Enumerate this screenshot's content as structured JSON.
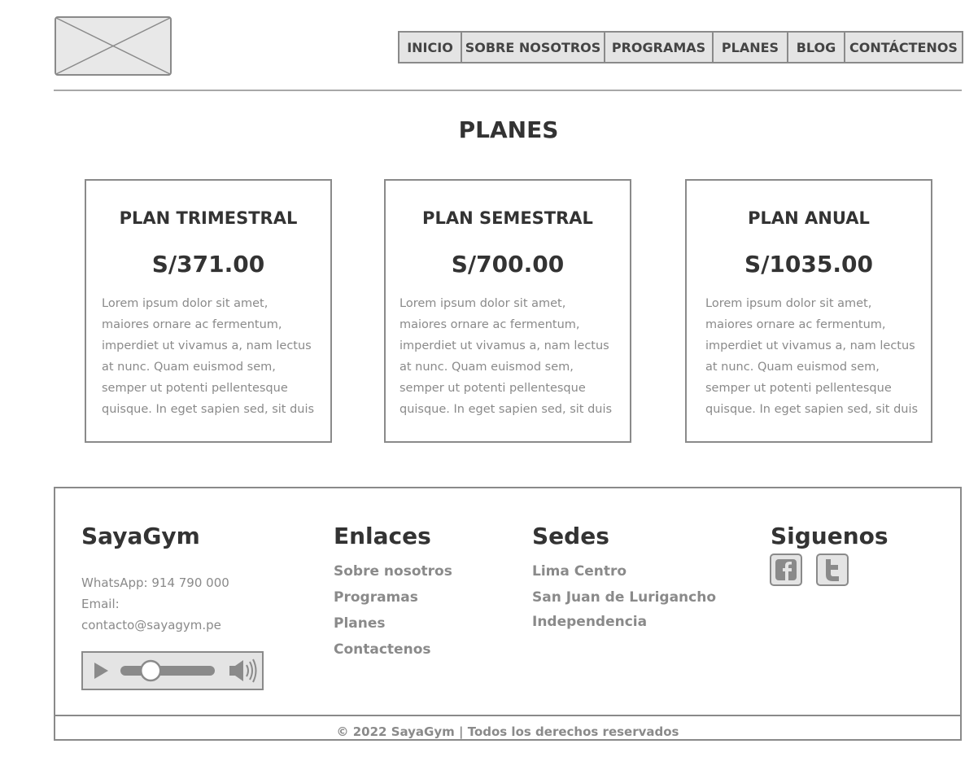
{
  "nav": {
    "items": [
      {
        "label": "INICIO"
      },
      {
        "label": "SOBRE NOSOTROS"
      },
      {
        "label": "PROGRAMAS"
      },
      {
        "label": "PLANES"
      },
      {
        "label": "BLOG"
      },
      {
        "label": "CONTÁCTENOS"
      }
    ]
  },
  "page": {
    "title": "PLANES"
  },
  "plans": [
    {
      "title": "PLAN TRIMESTRAL",
      "price": "S/371.00",
      "description": "Lorem ipsum dolor sit amet,\nmaiores ornare ac fermentum,\nimperdiet ut vivamus a, nam lectus\nat nunc. Quam euismod sem,\nsemper ut potenti pellentesque\nquisque. In eget sapien sed, sit duis"
    },
    {
      "title": "PLAN SEMESTRAL",
      "price": "S/700.00",
      "description": "Lorem ipsum dolor sit amet,\nmaiores ornare ac fermentum,\nimperdiet ut vivamus a, nam lectus\nat nunc. Quam euismod sem,\nsemper ut potenti pellentesque\nquisque. In eget sapien sed, sit duis"
    },
    {
      "title": "PLAN ANUAL",
      "price": "S/1035.00",
      "description": "Lorem ipsum dolor sit amet,\nmaiores ornare ac fermentum,\nimperdiet ut vivamus a, nam lectus\nat nunc. Quam euismod sem,\nsemper ut potenti pellentesque\nquisque. In eget sapien sed, sit duis"
    }
  ],
  "footer": {
    "brand": {
      "title": "SayaGym",
      "whatsapp": "WhatsApp: 914 790 000",
      "email_label": "Email:",
      "email": "contacto@sayagym.pe"
    },
    "links": {
      "title": "Enlaces",
      "items": [
        "Sobre nosotros",
        "Programas",
        "Planes",
        "Contactenos"
      ]
    },
    "locations": {
      "title": "Sedes",
      "items": [
        "Lima Centro",
        "San Juan de Lurigancho",
        "Independencia"
      ]
    },
    "social": {
      "title": "Siguenos",
      "icons": [
        "facebook-icon",
        "twitter-icon"
      ]
    },
    "audio_player": {
      "position": 0.3
    },
    "copyright": "© 2022 SayaGym | Todos los derechos reservados"
  },
  "colors": {
    "text_dark": "#333333",
    "text_muted": "#8a8a8a",
    "border": "#8a8a8a",
    "fill_light": "#e4e4e4"
  }
}
